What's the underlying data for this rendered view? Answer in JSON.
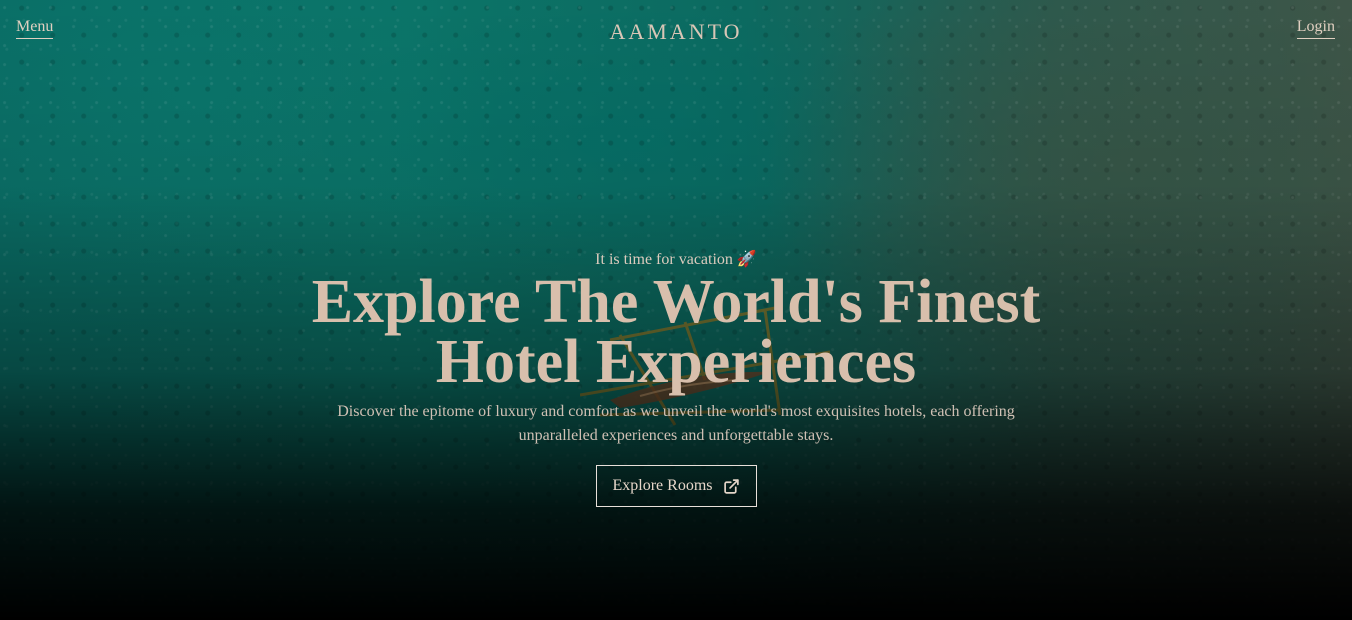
{
  "header": {
    "menu_label": "Menu",
    "brand": "AAMANTO",
    "login_label": "Login"
  },
  "hero": {
    "tagline": "It is time for vacation 🚀",
    "headline": "Explore The World's Finest Hotel Experiences",
    "subtitle": "Discover the epitome of luxury and comfort as we unveil the world's most exquisites hotels, each offering unparalleled experiences and unforgettable stays.",
    "cta_label": "Explore Rooms",
    "cta_icon": "external-link-icon"
  },
  "colors": {
    "text_accent": "#d8bfac",
    "water": "#0b7468",
    "shadow": "#000000"
  }
}
